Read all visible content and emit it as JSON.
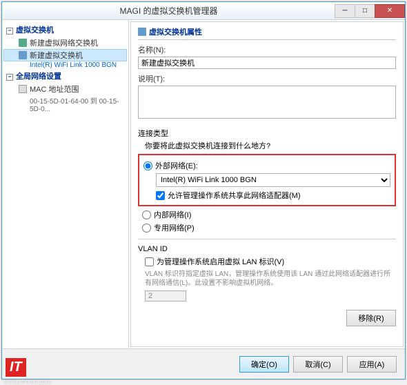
{
  "window": {
    "title": "MAGI 的虚拟交换机管理器"
  },
  "tree": {
    "group1": "虚拟交换机",
    "item1": "新建虚拟网络交换机",
    "item2": "新建虚拟交换机",
    "item2_sub": "Intel(R) WiFi Link 1000 BGN",
    "group2": "全局网络设置",
    "item3": "MAC 地址范围",
    "item3_sub": "00-15-5D-01-64-00 到 00-15-5D-0..."
  },
  "panel": {
    "heading": "虚拟交换机属性",
    "name_label": "名称(N):",
    "name_value": "新建虚拟交换机",
    "desc_label": "说明(T):",
    "desc_value": ""
  },
  "conn": {
    "title": "连接类型",
    "question": "你要将此虚拟交换机连接到什么地方?",
    "opt_external": "外部网络(E):",
    "adapter": "Intel(R) WiFi Link 1000 BGN",
    "share_check": "允许管理操作系统共享此网络适配器(M)",
    "opt_internal": "内部网络(I)",
    "opt_private": "专用网络(P)"
  },
  "vlan": {
    "title": "VLAN ID",
    "enable": "为管理操作系统启用虚拟 LAN 标识(V)",
    "hint": "VLAN 标识符指定虚拟 LAN，管理操作系统使用该 LAN 通过此网络适配器进行所有网络通信(L)。此设置不影响虚拟机网络。",
    "id_value": "2"
  },
  "buttons": {
    "remove": "移除(R)",
    "ok": "确定(O)",
    "cancel": "取消(C)",
    "apply": "应用(A)"
  },
  "watermark": {
    "logo": "IT",
    "url": "www.ithome.com"
  }
}
